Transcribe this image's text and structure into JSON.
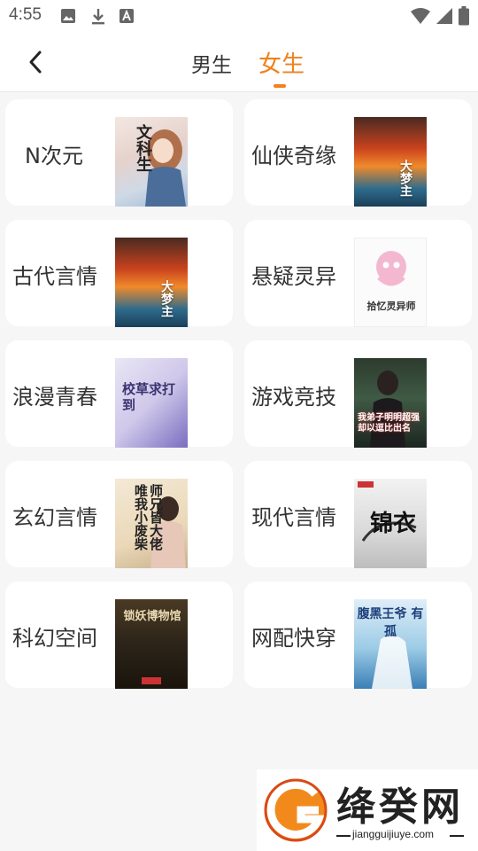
{
  "status_bar": {
    "time": "4:55",
    "left_icons": [
      "image-icon",
      "download-icon",
      "font-a-icon"
    ],
    "right_icons": [
      "wifi-icon",
      "signal-icon",
      "battery-icon"
    ]
  },
  "header": {
    "back_icon": "chevron-left-icon",
    "tabs": [
      {
        "label": "男生",
        "active": false
      },
      {
        "label": "女生",
        "active": true
      }
    ],
    "accent_color": "#f0811c"
  },
  "categories": [
    {
      "label": "N次元",
      "cover_title": "文科生"
    },
    {
      "label": "仙侠奇缘",
      "cover_title": "大梦主"
    },
    {
      "label": "古代言情",
      "cover_title": "大梦主"
    },
    {
      "label": "悬疑灵异",
      "cover_title": "拾忆灵异师"
    },
    {
      "label": "浪漫青春",
      "cover_title": "校草求打到"
    },
    {
      "label": "游戏竞技",
      "cover_title": "我弟子明明超强却以逗比出名"
    },
    {
      "label": "玄幻言情",
      "cover_title": "师兄皆大佬 唯我小废柴"
    },
    {
      "label": "现代言情",
      "cover_title": "锦衣"
    },
    {
      "label": "科幻空间",
      "cover_title": "锁妖博物馆"
    },
    {
      "label": "网配快穿",
      "cover_title": "腹黑王爷 有孤"
    }
  ],
  "watermark": {
    "name": "绛癸网",
    "url": "jiangguijiuye.com"
  }
}
